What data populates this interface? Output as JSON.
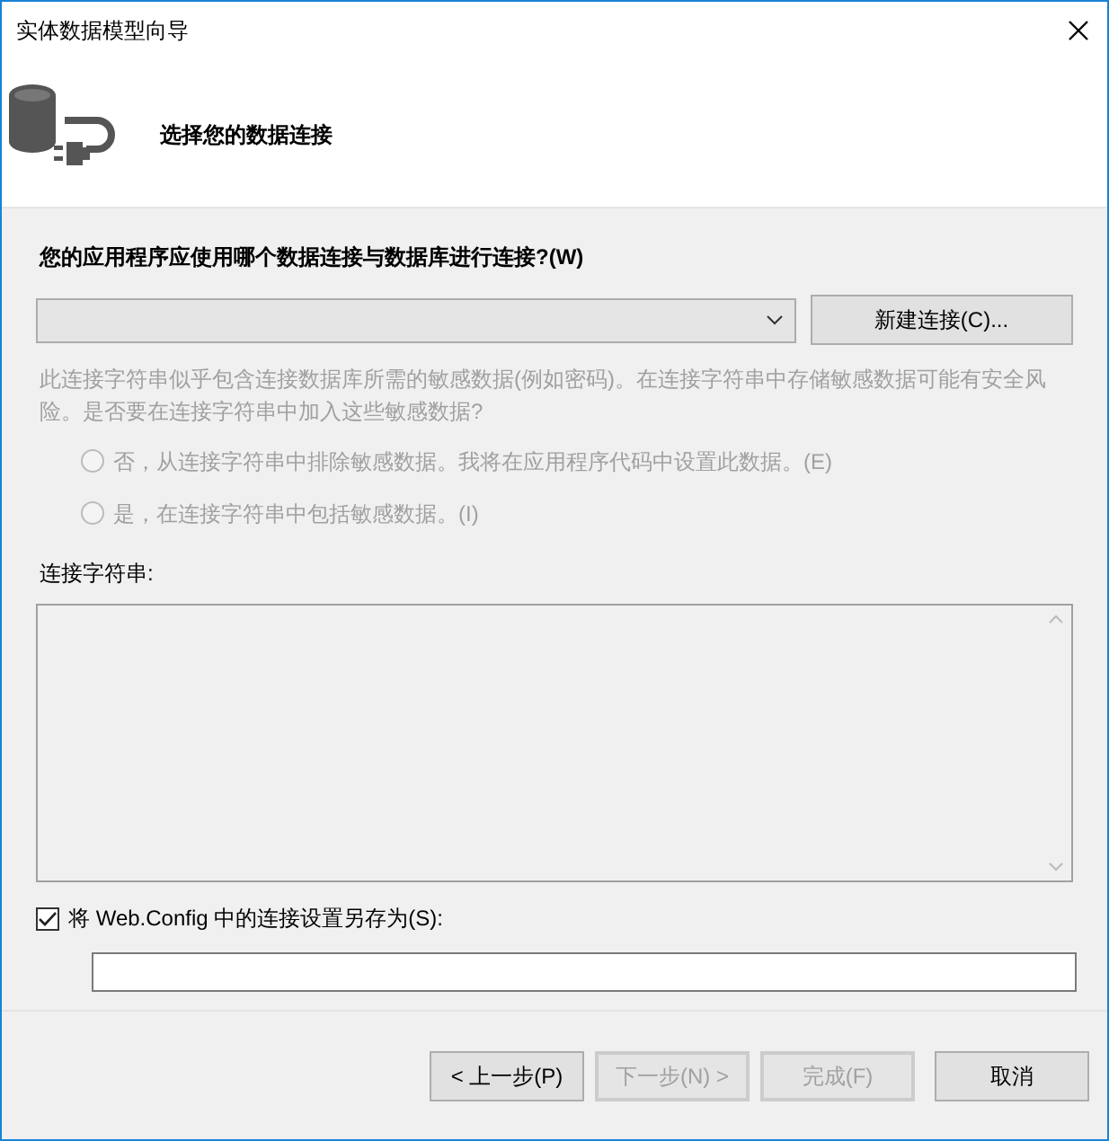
{
  "window": {
    "title": "实体数据模型向导"
  },
  "header": {
    "title": "选择您的数据连接"
  },
  "connection": {
    "label": "您的应用程序应使用哪个数据连接与数据库进行连接?(W)",
    "new_button": "新建连接(C)..."
  },
  "sensitive": {
    "note": "此连接字符串似乎包含连接数据库所需的敏感数据(例如密码)。在连接字符串中存储敏感数据可能有安全风险。是否要在连接字符串中加入这些敏感数据?",
    "disabled": true,
    "options": [
      {
        "label": "否，从连接字符串中排除敏感数据。我将在应用程序代码中设置此数据。(E)",
        "selected": false,
        "disabled": true
      },
      {
        "label": "是，在连接字符串中包括敏感数据。(I)",
        "selected": false,
        "disabled": true
      }
    ]
  },
  "connection_string": {
    "label": "连接字符串:"
  },
  "save_config": {
    "label": "将 Web.Config 中的连接设置另存为(S):",
    "checked": true
  },
  "buttons": [
    {
      "label": "< 上一步(P)",
      "disabled": false
    },
    {
      "label": "下一步(N) >",
      "disabled": true
    },
    {
      "label": "完成(F)",
      "disabled": true
    },
    {
      "label": "取消",
      "disabled": false
    }
  ]
}
